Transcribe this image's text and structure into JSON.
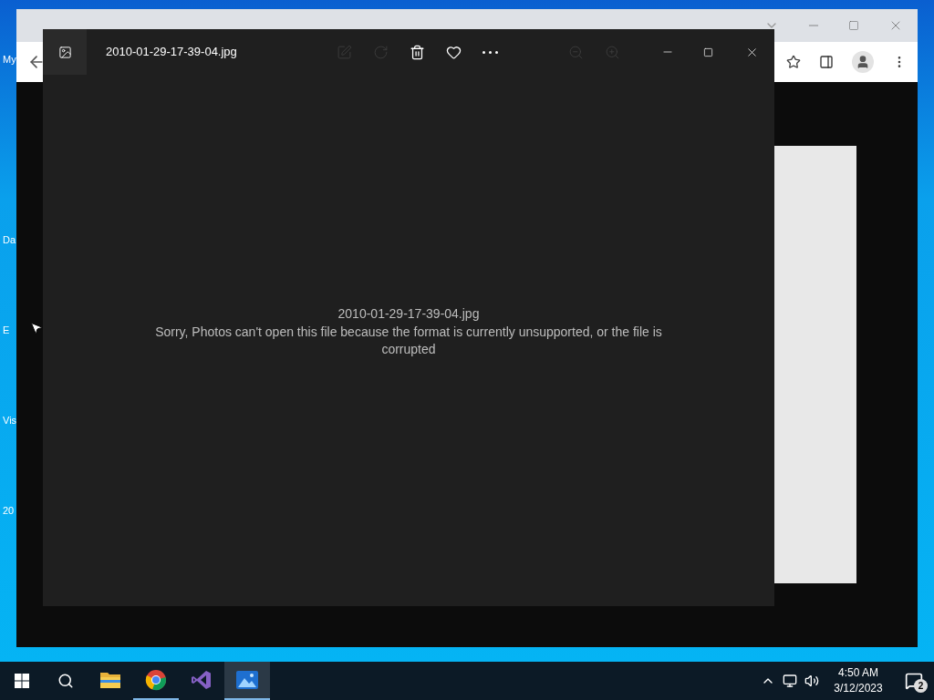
{
  "desktop": {
    "icons": [
      {
        "label": "My"
      },
      {
        "label": "Da"
      },
      {
        "label": "E"
      },
      {
        "label": "Vis"
      },
      {
        "label": "20"
      }
    ]
  },
  "photos": {
    "title": "2010-01-29-17-39-04.jpg",
    "toolbar": [
      {
        "kind": "edit",
        "disabled": true
      },
      {
        "kind": "rotate",
        "disabled": true
      },
      {
        "kind": "delete",
        "disabled": false
      },
      {
        "kind": "favorite",
        "disabled": false
      },
      {
        "kind": "more",
        "disabled": false
      },
      {
        "kind": "zoom-out",
        "disabled": true
      },
      {
        "kind": "zoom-in",
        "disabled": true
      }
    ],
    "error": {
      "filename": "2010-01-29-17-39-04.jpg",
      "message": "Sorry, Photos can't open this file because the format is currently unsupported, or the file is corrupted"
    }
  },
  "taskbar": {
    "apps": [
      {
        "kind": "explorer",
        "running": false,
        "selected": false
      },
      {
        "kind": "chrome",
        "running": true,
        "selected": false
      },
      {
        "kind": "studio",
        "running": false,
        "selected": false
      },
      {
        "kind": "photos",
        "running": true,
        "selected": true
      }
    ],
    "clock": {
      "time": "4:50 AM",
      "date": "3/12/2023"
    },
    "notifications": {
      "count": "2"
    }
  }
}
